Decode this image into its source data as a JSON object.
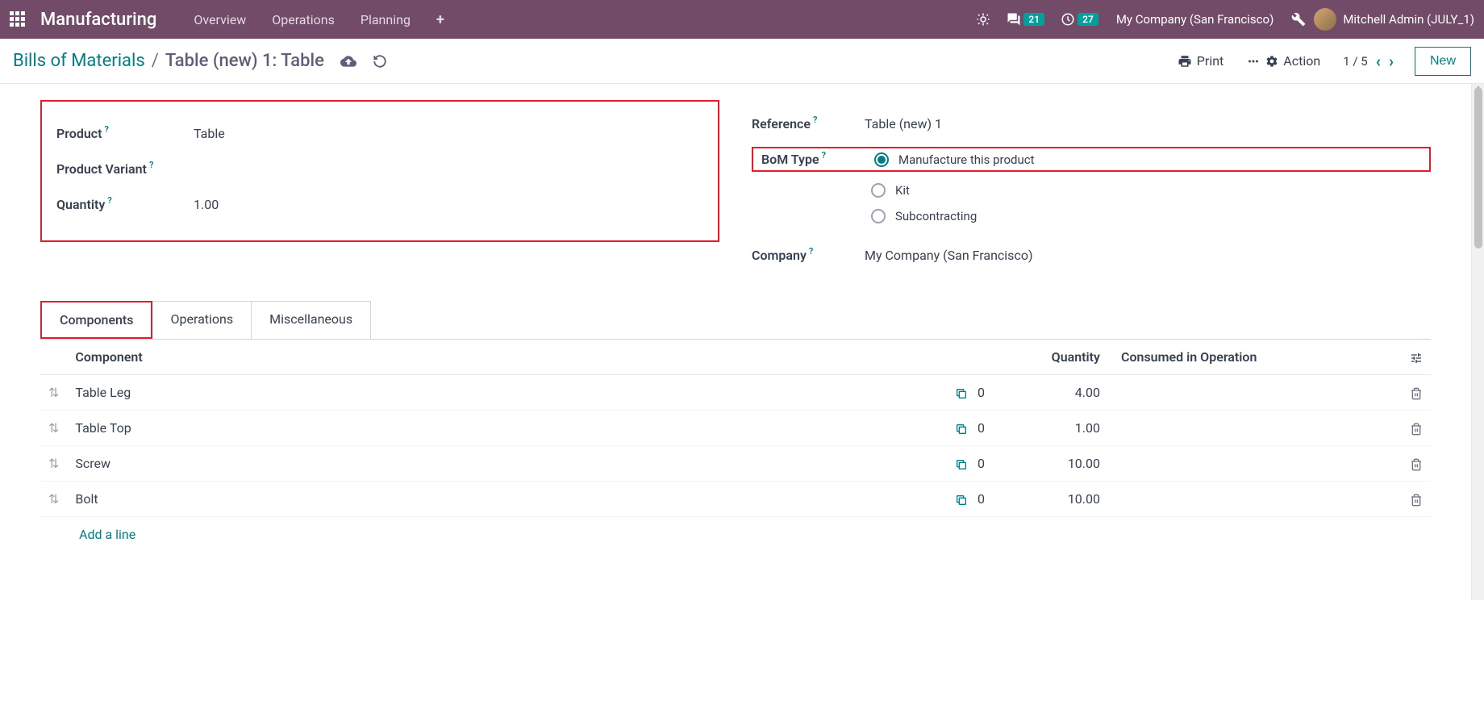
{
  "topbar": {
    "app_title": "Manufacturing",
    "nav": [
      "Overview",
      "Operations",
      "Planning"
    ],
    "messages_badge": "21",
    "activities_badge": "27",
    "company": "My Company (San Francisco)",
    "user": "Mitchell Admin (JULY_1)"
  },
  "subbar": {
    "breadcrumb_root": "Bills of Materials",
    "breadcrumb_current": "Table (new) 1: Table",
    "print_label": "Print",
    "action_label": "Action",
    "pager": "1 / 5",
    "new_label": "New"
  },
  "form": {
    "product_label": "Product",
    "product_value": "Table",
    "variant_label": "Product Variant",
    "variant_value": "",
    "quantity_label": "Quantity",
    "quantity_value": "1.00",
    "reference_label": "Reference",
    "reference_value": "Table (new) 1",
    "bomtype_label": "BoM Type",
    "bomtype_options": [
      "Manufacture this product",
      "Kit",
      "Subcontracting"
    ],
    "company_label": "Company",
    "company_value": "My Company (San Francisco)"
  },
  "tabs": [
    "Components",
    "Operations",
    "Miscellaneous"
  ],
  "table": {
    "headers": {
      "component": "Component",
      "quantity": "Quantity",
      "consumed": "Consumed in Operation"
    },
    "rows": [
      {
        "name": "Table Leg",
        "extra": "0",
        "qty": "4.00"
      },
      {
        "name": "Table Top",
        "extra": "0",
        "qty": "1.00"
      },
      {
        "name": "Screw",
        "extra": "0",
        "qty": "10.00"
      },
      {
        "name": "Bolt",
        "extra": "0",
        "qty": "10.00"
      }
    ],
    "add_line": "Add a line"
  }
}
